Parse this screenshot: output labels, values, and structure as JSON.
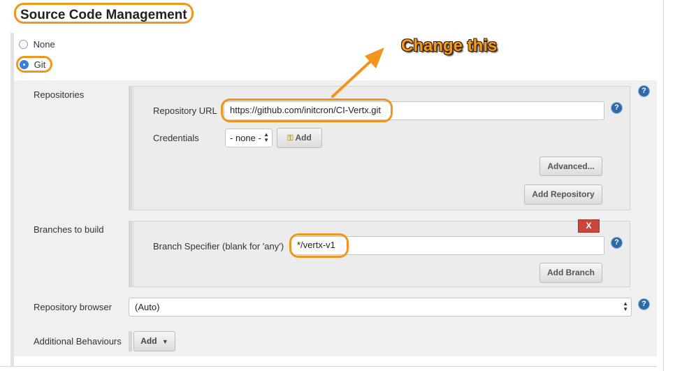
{
  "section": {
    "title": "Source Code Management"
  },
  "scm_options": [
    {
      "label": "None",
      "selected": false
    },
    {
      "label": "Git",
      "selected": true
    }
  ],
  "repositories": {
    "label": "Repositories",
    "url_label": "Repository URL",
    "url_value": "https://github.com/initcron/CI-Vertx.git",
    "credentials_label": "Credentials",
    "credentials_value": "- none -",
    "add_label": "Add",
    "advanced_label": "Advanced...",
    "add_repository_label": "Add Repository"
  },
  "branches": {
    "label": "Branches to build",
    "specifier_label": "Branch Specifier (blank for 'any')",
    "specifier_value": "*/vertx-v1",
    "delete_label": "X",
    "add_branch_label": "Add Branch"
  },
  "repository_browser": {
    "label": "Repository browser",
    "value": "(Auto)"
  },
  "additional_behaviours": {
    "label": "Additional Behaviours",
    "add_label": "Add"
  },
  "annotation": {
    "text": "Change this"
  },
  "help": {
    "glyph": "?"
  },
  "colors": {
    "highlight": "#f0961e",
    "help_icon": "#2e6aa8",
    "delete_button": "#c9463d"
  }
}
